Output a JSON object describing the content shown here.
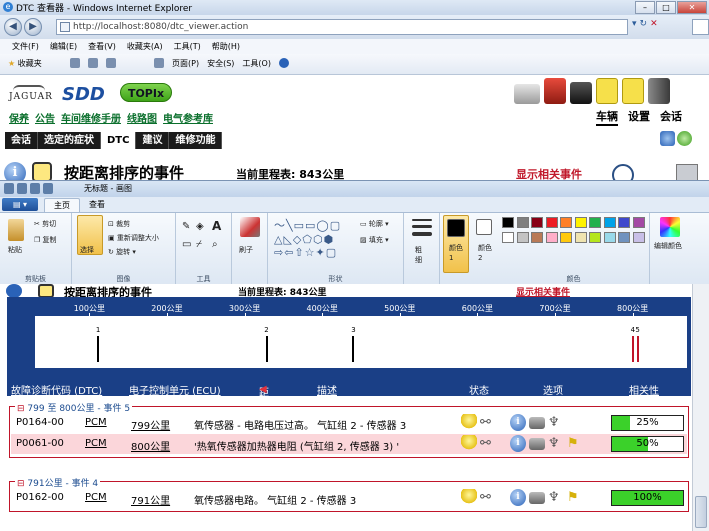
{
  "browser": {
    "title": "DTC 查看器 - Windows Internet Explorer",
    "url": "http://localhost:8080/dtc_viewer.action",
    "menu": [
      "文件(F)",
      "编辑(E)",
      "查看(V)",
      "收藏夹(A)",
      "工具(T)",
      "帮助(H)"
    ],
    "favorites": "收藏夹",
    "commands": [
      "页面(P)",
      "安全(S)",
      "工具(O)"
    ]
  },
  "sdd": {
    "brand": "JAGUAR",
    "logo": "SDD",
    "topix": "TOPIx",
    "links": [
      "保养",
      "公告",
      "车间维修手册",
      "线路图",
      "电气参考库"
    ],
    "tabs": [
      "车辆",
      "设置",
      "会话"
    ],
    "nav": [
      "会话",
      "选定的症状",
      "DTC",
      "建议",
      "维修功能"
    ],
    "event_title": "按距离排序的事件",
    "mileage": "当前里程表: 843公里",
    "related": "显示相关事件",
    "colors": {
      "nav": "#1b1b1b",
      "links": "#0a6f2c",
      "panel": "#1a3f86",
      "group_border": "#c0152a",
      "highlight": "#fbd6da",
      "bar": "#3bd12a"
    }
  },
  "paint": {
    "title": "无标题 - 画图",
    "tabs": [
      "主页",
      "查看"
    ],
    "clipboard": {
      "paste": "粘贴",
      "cut": "剪切",
      "copy": "复制",
      "label": "剪贴板"
    },
    "image": {
      "select": "选择",
      "crop": "裁剪",
      "resize": "重新调整大小",
      "rotate": "旋转",
      "label": "图像"
    },
    "tools_label": "工具",
    "brush": "刷子",
    "shapes": {
      "outline": "轮廓",
      "fill": "填充",
      "label": "形状"
    },
    "size": "粗细",
    "color1": "颜色 1",
    "color2": "颜色 2",
    "edit_colors": "编辑颜色",
    "colors_label": "颜色",
    "palette": [
      "#000000",
      "#7f7f7f",
      "#880015",
      "#ed1c24",
      "#ff7f27",
      "#fff200",
      "#22b14c",
      "#00a2e8",
      "#3f48cc",
      "#a349a4",
      "#ffffff",
      "#c3c3c3",
      "#b97a57",
      "#ffaec9",
      "#ffc90e",
      "#efe4b0",
      "#b5e61d",
      "#99d9ea",
      "#7092be",
      "#c8bfe7"
    ]
  },
  "timeline": {
    "ticks": [
      "100公里",
      "200公里",
      "300公里",
      "400公里",
      "500公里",
      "600公里",
      "700公里",
      "800公里"
    ],
    "tick_values": [
      100,
      200,
      300,
      400,
      500,
      600,
      700,
      800
    ],
    "range": [
      30,
      870
    ],
    "events": [
      {
        "label": "1",
        "km": 110,
        "color": "#000000"
      },
      {
        "label": "2",
        "km": 327,
        "color": "#000000"
      },
      {
        "label": "3",
        "km": 439,
        "color": "#000000"
      },
      {
        "label": "4",
        "km": 799,
        "color": "#c0152a"
      },
      {
        "label": "5",
        "km": 805,
        "color": "#c0152a"
      }
    ]
  },
  "columns": [
    "故障诊断代码 (DTC)",
    "电子控制单元 (ECU)",
    "距离",
    "描述",
    "状态",
    "选项",
    "相关性"
  ],
  "groups": [
    {
      "label": "799 至 800公里 - 事件 5",
      "rows": [
        {
          "dtc": "P0164-00",
          "ecu": "PCM",
          "dist": "799公里",
          "desc": "氧传感器 - 电路电压过高。 气缸组 2 - 传感器 3",
          "relevance": 25,
          "relevance_text": "25%",
          "highlight": false,
          "has_arrow": false
        },
        {
          "dtc": "P0061-00",
          "ecu": "PCM",
          "dist": "800公里",
          "desc": "'热氧传感器加热器电阻 (气缸组 2, 传感器 3) '",
          "relevance": 50,
          "relevance_text": "50%",
          "highlight": true,
          "has_arrow": true
        }
      ]
    },
    {
      "label": "791公里 - 事件 4",
      "rows": [
        {
          "dtc": "P0162-00",
          "ecu": "PCM",
          "dist": "791公里",
          "desc": "氧传感器电路。 气缸组 2 - 传感器 3",
          "relevance": 100,
          "relevance_text": "100%",
          "highlight": false,
          "has_arrow": true
        }
      ]
    }
  ]
}
